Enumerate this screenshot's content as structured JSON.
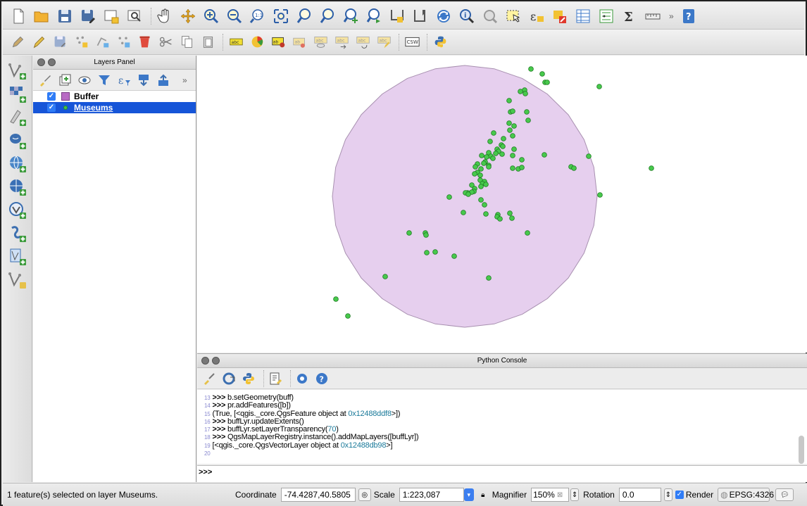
{
  "layers_panel": {
    "title": "Layers Panel",
    "layers": [
      {
        "name": "Buffer",
        "checked": true,
        "selected": false,
        "symbol": "fill",
        "color": "#b86ac4"
      },
      {
        "name": "Museums",
        "checked": true,
        "selected": true,
        "symbol": "point",
        "color": "#45c24a"
      }
    ]
  },
  "map": {
    "buffer_fill": "#e6cfee",
    "buffer_stroke": "#a890b0",
    "point_fill": "#47c94c",
    "point_stroke": "#1f7a22"
  },
  "python_console": {
    "title": "Python Console",
    "lines": [
      {
        "num": "13",
        "prompt": ">>>",
        "code": "b.setGeometry(buff)",
        "addr": ""
      },
      {
        "num": "14",
        "prompt": ">>>",
        "code": "pr.addFeatures([b])",
        "addr": ""
      },
      {
        "num": "15",
        "prompt": "",
        "code": "(True, [<qgis._core.QgsFeature object at ",
        "addr": "0x12488ddf8",
        "tail": ">])"
      },
      {
        "num": "16",
        "prompt": ">>>",
        "code": "buffLyr.updateExtents()",
        "addr": ""
      },
      {
        "num": "17",
        "prompt": ">>>",
        "code": "buffLyr.setLayerTransparency(",
        "addr": "70",
        "tail": ")"
      },
      {
        "num": "18",
        "prompt": ">>>",
        "code": "QgsMapLayerRegistry.instance().addMapLayers([buffLyr])",
        "addr": ""
      },
      {
        "num": "19",
        "prompt": "",
        "code": "[<qgis._core.QgsVectorLayer object at ",
        "addr": "0x12488db98",
        "tail": ">]"
      },
      {
        "num": "20",
        "prompt": "",
        "code": "",
        "addr": ""
      }
    ],
    "input_prompt": ">>>"
  },
  "status_bar": {
    "message": "1 feature(s) selected on layer Museums.",
    "coordinate_label": "Coordinate",
    "coordinate_value": "-74.4287,40.5805",
    "scale_label": "Scale",
    "scale_value": "1:223,087",
    "magnifier_label": "Magnifier",
    "magnifier_value": "150%",
    "rotation_label": "Rotation",
    "rotation_value": "0.0",
    "render_label": "Render",
    "render_checked": true,
    "crs_label": "EPSG:4326"
  }
}
